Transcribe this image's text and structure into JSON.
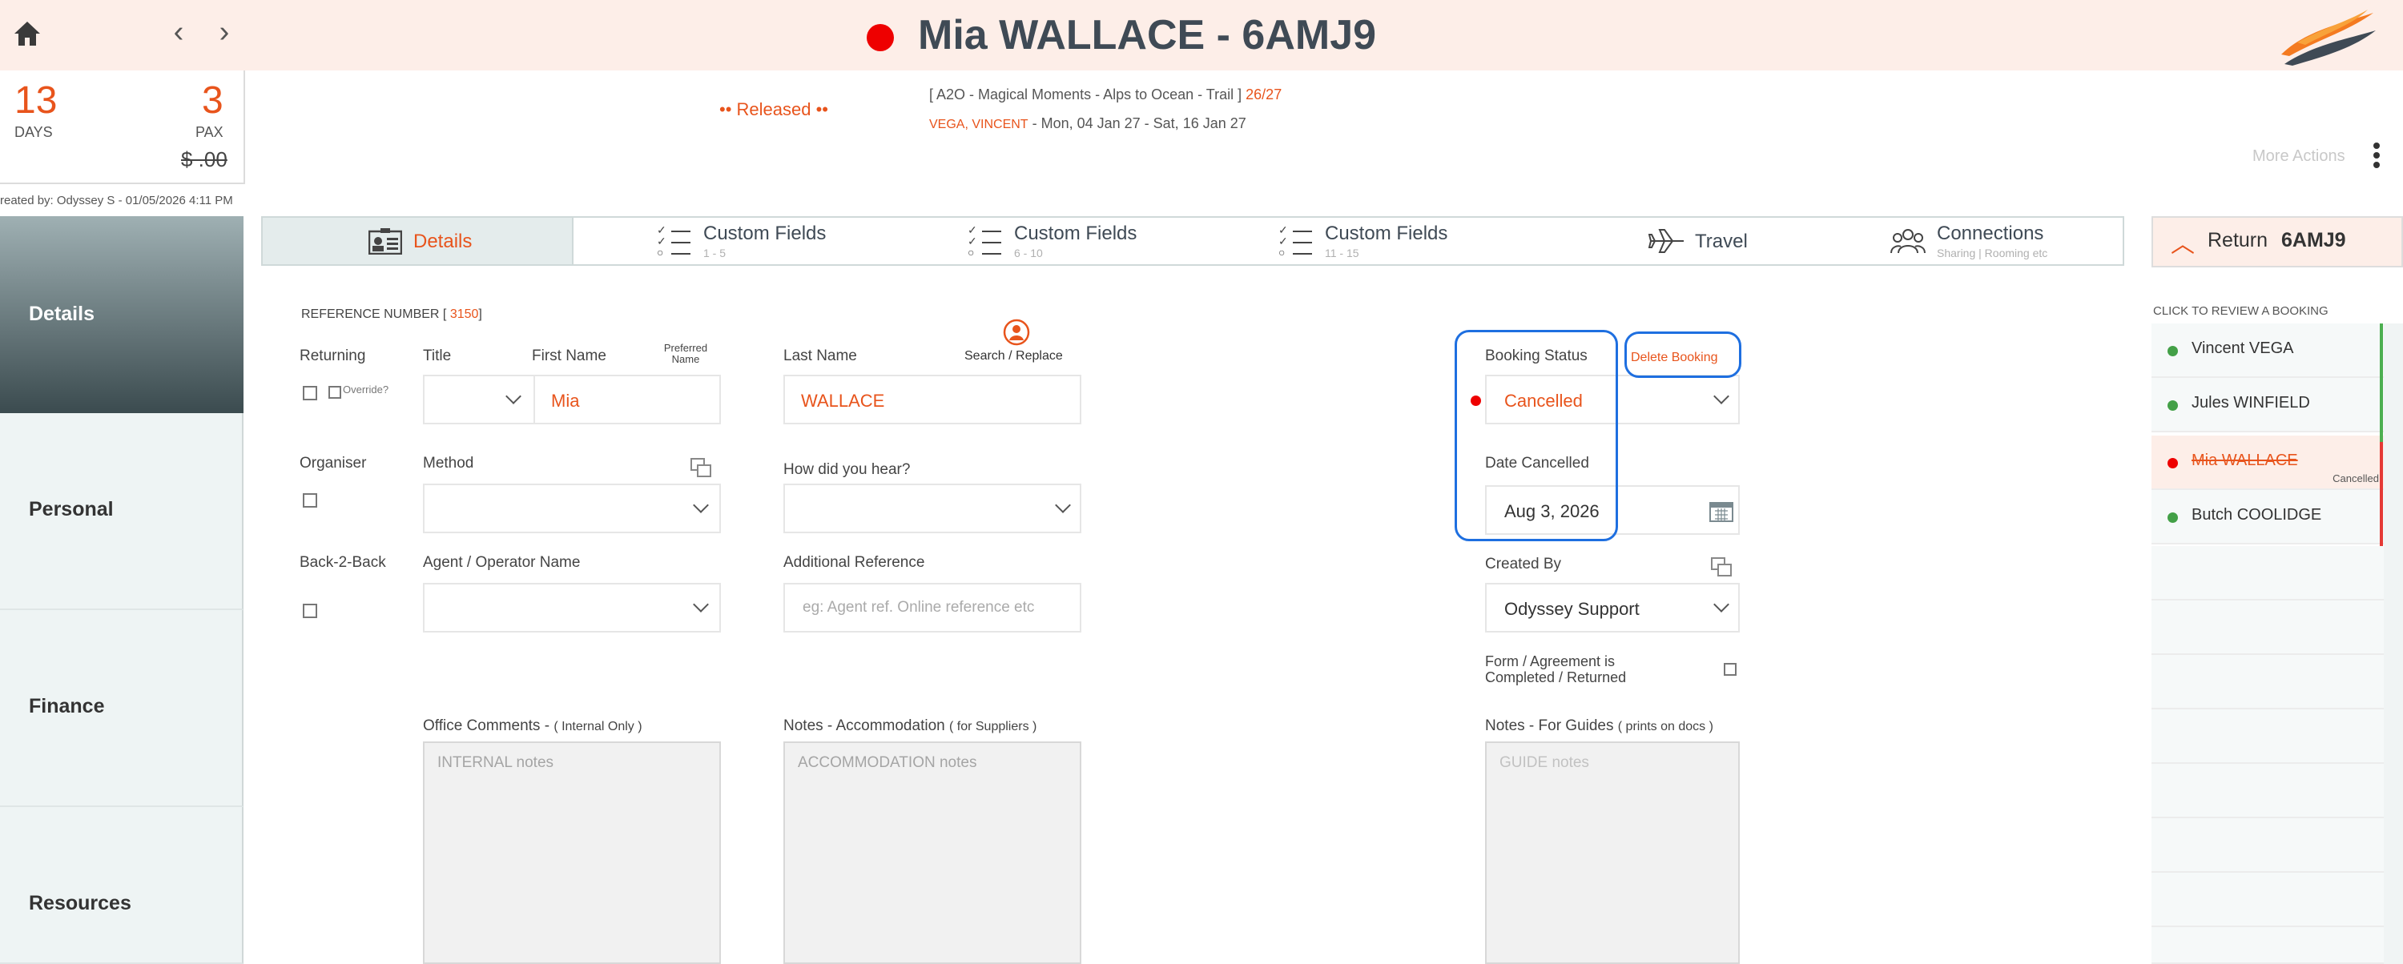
{
  "header": {
    "title": "Mia WALLACE - 6AMJ9",
    "status_color": "#ee0000"
  },
  "stats": {
    "days": "13",
    "days_label": "DAYS",
    "pax": "3",
    "pax_label": "PAX",
    "price": "$ .00",
    "created_line": "reated by: Odyssey S - 01/05/2026 4:11 PM"
  },
  "tour": {
    "released": "•• Released ••",
    "name": "[ A2O - Magical Moments - Alps to Ocean - Trail ]",
    "seats": "26/27",
    "guide": "VEGA, VINCENT",
    "dates": "- Mon, 04 Jan 27 - Sat, 16 Jan 27",
    "more_actions": "More Actions"
  },
  "sidebar": {
    "items": [
      {
        "label": "Details"
      },
      {
        "label": "Personal"
      },
      {
        "label": "Finance"
      },
      {
        "label": "Resources"
      }
    ]
  },
  "tabs": [
    {
      "label": "Details",
      "sub": ""
    },
    {
      "label": "Custom Fields",
      "sub": "1 - 5"
    },
    {
      "label": "Custom Fields",
      "sub": "6 - 10"
    },
    {
      "label": "Custom Fields",
      "sub": "11 - 15"
    },
    {
      "label": "Travel",
      "sub": ""
    },
    {
      "label": "Connections",
      "sub": "Sharing | Rooming etc"
    }
  ],
  "form": {
    "reference_label": "REFERENCE NUMBER [",
    "reference_number": "3150",
    "reference_close": "]",
    "returning_label": "Returning",
    "override_label": "Override?",
    "title_label": "Title",
    "first_name_label": "First Name",
    "preferred_name_label": "Preferred Name",
    "first_name_value": "Mia",
    "last_name_label": "Last Name",
    "last_name_value": "WALLACE",
    "search_replace_label": "Search / Replace",
    "organiser_label": "Organiser",
    "method_label": "Method",
    "how_hear_label": "How did you hear?",
    "back2back_label": "Back-2-Back",
    "agent_label": "Agent / Operator Name",
    "additional_ref_label": "Additional Reference",
    "additional_ref_placeholder": "eg: Agent ref. Online reference etc",
    "booking_status_label": "Booking Status",
    "booking_status_value": "Cancelled",
    "delete_booking_label": "Delete Booking",
    "date_cancelled_label": "Date Cancelled",
    "date_cancelled_value": "Aug 3, 2026",
    "created_by_label": "Created By",
    "created_by_value": "Odyssey Support",
    "form_agreement_label_1": "Form / Agreement is",
    "form_agreement_label_2": "Completed / Returned",
    "office_comments_label": "Office Comments - ",
    "office_comments_note": "( Internal Only )",
    "office_comments_placeholder": "INTERNAL notes",
    "notes_accom_label": "Notes - Accommodation ",
    "notes_accom_note": "( for Suppliers )",
    "notes_accom_placeholder": "ACCOMMODATION notes",
    "notes_guides_label": "Notes - For Guides ",
    "notes_guides_note": "( prints on docs )",
    "notes_guides_placeholder": "GUIDE notes"
  },
  "return_panel": {
    "return_label": "Return",
    "booking_code": "6AMJ9",
    "click_review": "CLICK TO REVIEW A BOOKING",
    "passengers": [
      {
        "name": "Vincent VEGA",
        "status": "",
        "dot_color": "#43a047"
      },
      {
        "name": "Jules WINFIELD",
        "status": "",
        "dot_color": "#43a047"
      },
      {
        "name": "Mia WALLACE",
        "status": "Cancelled",
        "dot_color": "#ee0000"
      },
      {
        "name": "Butch COOLIDGE",
        "status": "",
        "dot_color": "#43a047"
      }
    ]
  },
  "colors": {
    "accent": "#e8541c",
    "highlight": "#1e6fe0",
    "active_green": "#43a047"
  }
}
